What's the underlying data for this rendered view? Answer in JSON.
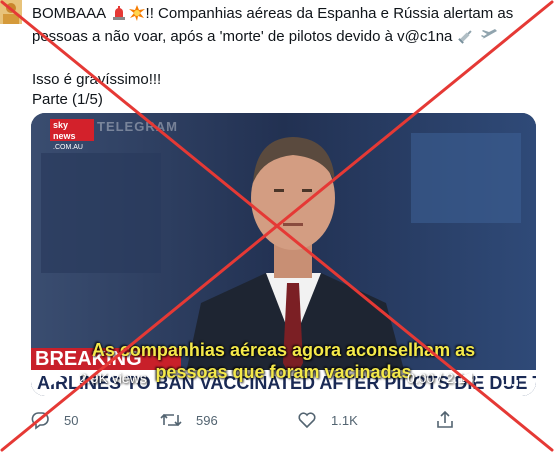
{
  "tweet": {
    "line1_a": "BOMBAAA",
    "line1_b": "!! Companhias aéreas da Espanha e Rússia alertam as",
    "line2_a": "pessoas a não voar, após a 'morte' de pilotos devido à v@c1na",
    "line3": "Isso é gravíssimo!!!",
    "line4": "Parte (1/5)"
  },
  "video": {
    "channel_logo": "sky news",
    "channel_domain": ".COM.AU",
    "watermark": "TELEGRAM",
    "banner_top": "BREAKING NEWS",
    "banner_bottom": "AIRLINES TO BAN VACCINATED AFTER PILOTS DIE DUE TO VACCINE",
    "subtitle_line1": "As companhias aéreas agora aconselham as",
    "subtitle_line2": "pessoas que foram vacinadas",
    "views": "2.9K views",
    "time": "0:00 / 2:18"
  },
  "actions": {
    "reply_count": "50",
    "retweet_count": "596",
    "like_count": "1.1K"
  },
  "colors": {
    "cross": "#e53935",
    "subtitle": "#f4e94a",
    "icon_gray": "#536471"
  },
  "icons": [
    "avatar",
    "alarm-light-icon",
    "explosion-icon",
    "syringe-icon",
    "airplane-icon",
    "play-icon",
    "volume-icon",
    "fullscreen-icon",
    "reply-icon",
    "retweet-icon",
    "like-icon",
    "share-icon"
  ]
}
